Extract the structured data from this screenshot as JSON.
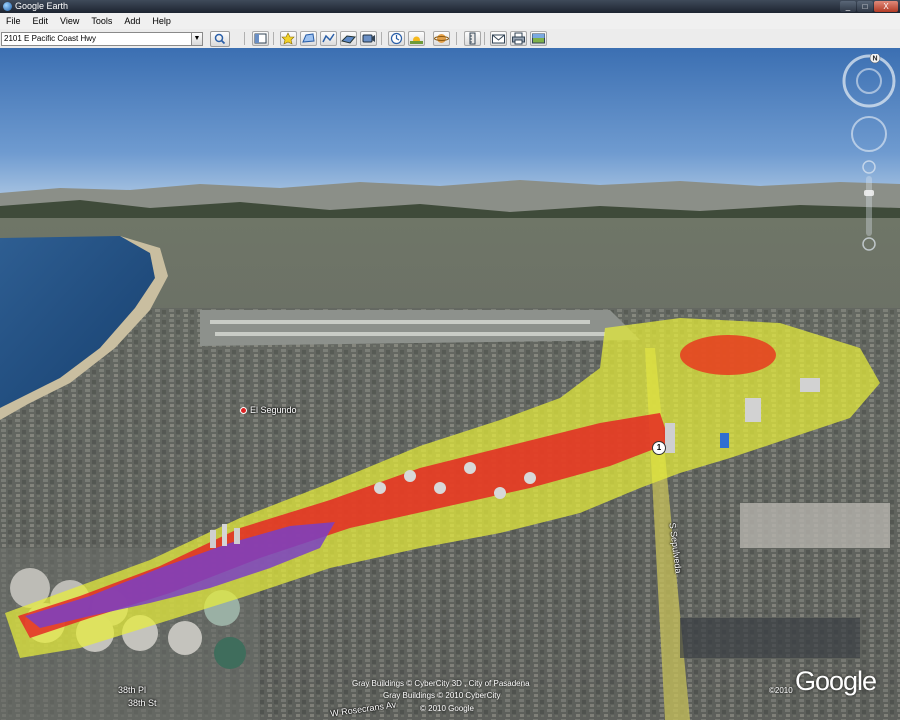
{
  "window": {
    "title": "Google Earth",
    "controls": {
      "minimize": "_",
      "maximize": "□",
      "close": "X"
    }
  },
  "menu": [
    "File",
    "Edit",
    "View",
    "Tools",
    "Add",
    "Help"
  ],
  "search": {
    "value": "2101 E Pacific Coast Hwy",
    "dropdown_glyph": "▼"
  },
  "toolbar": {
    "icons": [
      "sidebar-toggle-icon",
      "placemark-icon",
      "polygon-icon",
      "path-icon",
      "image-overlay-icon",
      "record-tour-icon",
      "historical-imagery-icon",
      "sunlight-icon",
      "planets-icon",
      "ruler-icon",
      "email-icon",
      "print-icon",
      "save-image-icon"
    ]
  },
  "map": {
    "place_label": "El Segundo",
    "highway_shield": "1",
    "streets": {
      "w38th_pl": "38th Pl",
      "w38th_st": "38th St",
      "rosecrans": "W Rosecrans Av",
      "sepulveda": "S Sepulveda"
    },
    "compass_n": "N",
    "colors": {
      "sky": "#4a7fbf",
      "yellow_zone": "#e8ee3a",
      "red_zone": "#e52222",
      "purple_zone": "#7a3fc4",
      "ocean": "#1f4f86"
    }
  },
  "credits": {
    "line1": "Gray Buildings © CyberCity 3D , City of Pasadena",
    "line2": "Gray Buildings © 2010 CyberCity",
    "line3": "© 2010 Google",
    "year": "©2010",
    "logo": "Google"
  }
}
